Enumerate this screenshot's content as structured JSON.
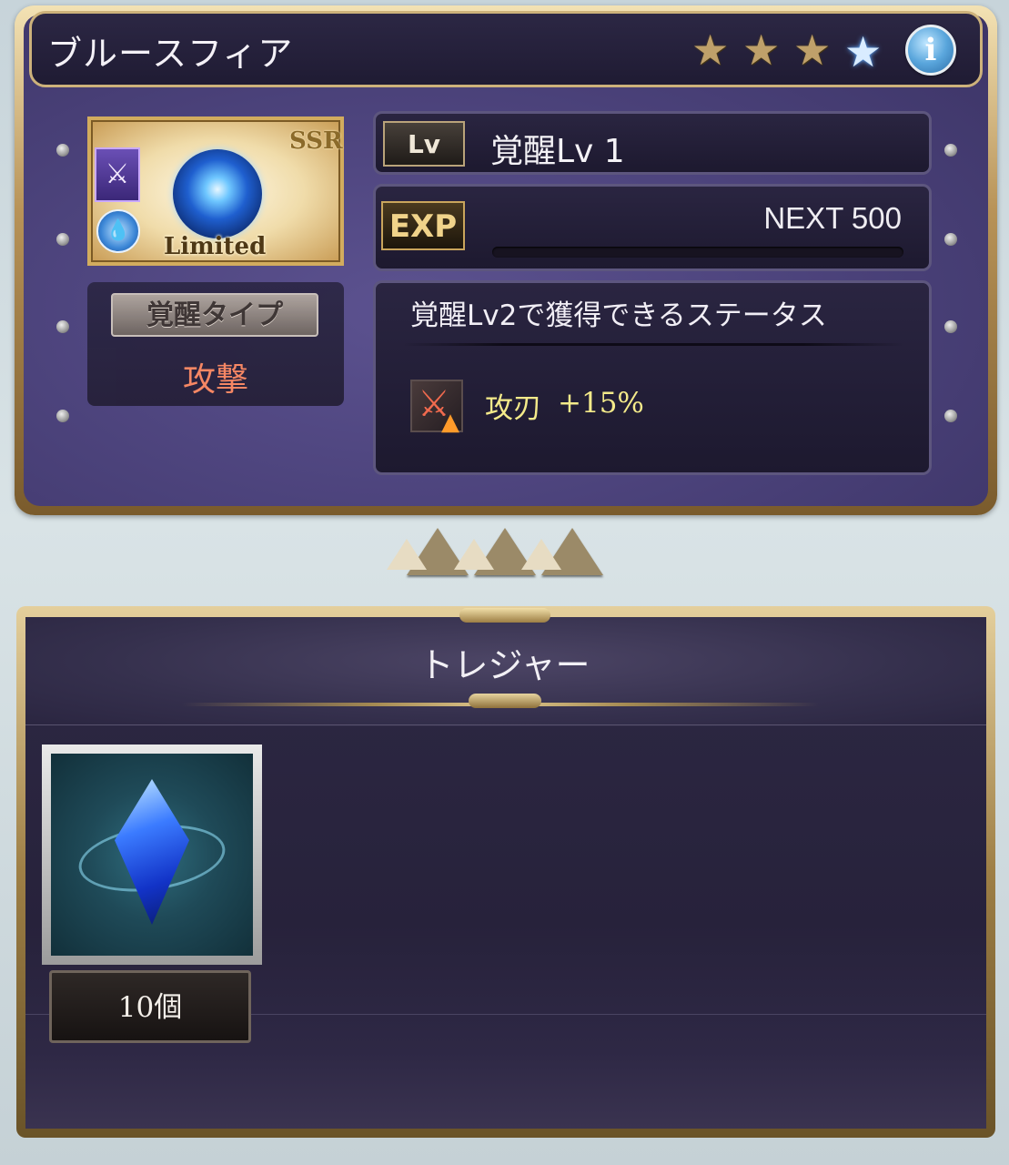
{
  "summon": {
    "name": "ブルースフィア",
    "stars": [
      {
        "type": "gold",
        "icon": "star-gold-icon"
      },
      {
        "type": "gold",
        "icon": "star-gold-icon"
      },
      {
        "type": "gold",
        "icon": "star-gold-icon"
      },
      {
        "type": "blue",
        "icon": "star-blue-icon"
      }
    ],
    "info_button_label": "i",
    "rarity": "SSR",
    "limited_label": "Limited",
    "class_icon": "crossed-swords-icon",
    "element_icon": "water-element-icon"
  },
  "awakening": {
    "type_label": "覚醒タイプ",
    "type_value": "攻撃",
    "lv_tag": "Lv",
    "lv_text": "覚醒Lv 1",
    "exp_tag": "EXP",
    "exp_next": "NEXT 500",
    "exp_progress": 0.0,
    "status_title": "覚醒Lv2で獲得できるステータス",
    "status": [
      {
        "icon": "attack-blade-up-icon",
        "name": "攻刃",
        "value": "+15%"
      }
    ]
  },
  "treasure": {
    "title": "トレジャー",
    "items": [
      {
        "icon": "blue-crystal-icon",
        "count": "10個"
      }
    ]
  },
  "colors": {
    "type_value": "#ff8b63",
    "status_text": "#f4ea8a",
    "gold_trim": "#cdb27b",
    "panel_bg": "#4a4179"
  }
}
